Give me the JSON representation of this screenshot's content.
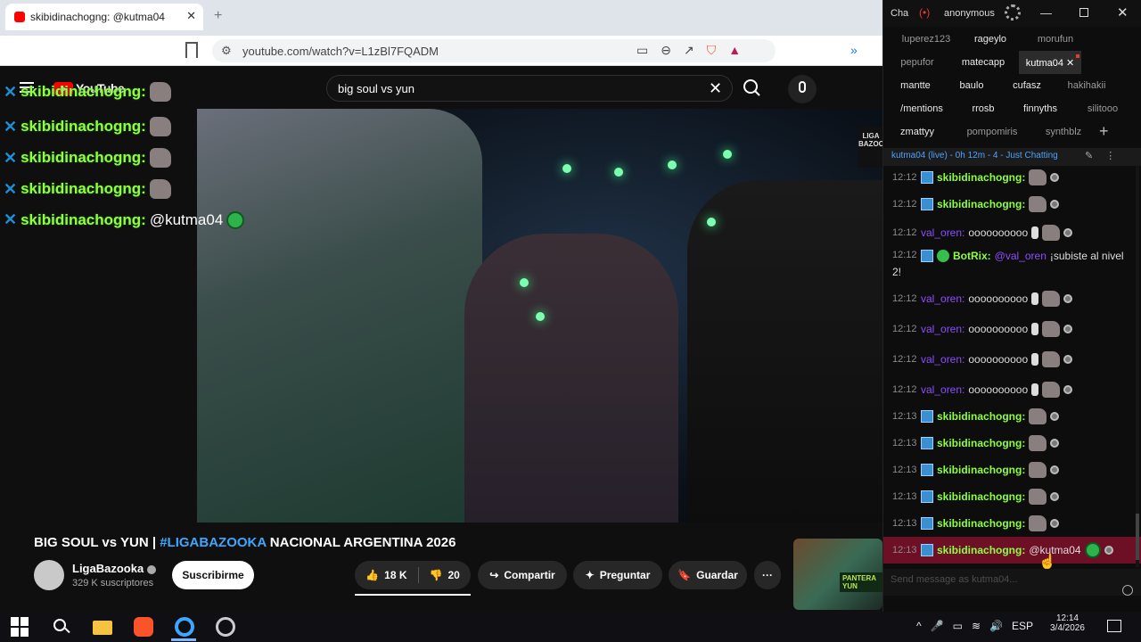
{
  "browser": {
    "tab_title": "skibidinachogng: @kutma04",
    "address_url": "youtube.com/watch?v=L1zBl7FQADM"
  },
  "youtube": {
    "logo_text": "YouTube",
    "search_query": "big soul vs yun",
    "video_title_main": "BIG SOUL vs YUN | ",
    "video_title_tag": "#LIGABAZOOKA",
    "video_title_rest": " NACIONAL ARGENTINA 2026",
    "channel_name": "LigaBazooka",
    "subscribers": "329 K suscriptores",
    "subscribe_label": "Suscribirme",
    "like_count": "18 K",
    "dislike_count": "20",
    "share_label": "Compartir",
    "ask_label": "Preguntar",
    "save_label": "Guardar",
    "more_label": "···",
    "video_badge": "LIGA BAZOOKA",
    "thumb_label": "PANTERA YUN"
  },
  "overlay": {
    "username": "skibidinachogng:",
    "lines": [
      "",
      "",
      "",
      "",
      "@kutma04"
    ]
  },
  "chatterino": {
    "app": "Cha",
    "user": "anonymous",
    "tabs": [
      {
        "label": "luperez123"
      },
      {
        "label": "rageylo"
      },
      {
        "label": "morufun"
      },
      {
        "label": "pepufor"
      },
      {
        "label": "matecapp"
      },
      {
        "label": "kutma04 ✕"
      },
      {
        "label": "mantte"
      },
      {
        "label": "baulo"
      },
      {
        "label": "cufasz"
      },
      {
        "label": "hakihakii"
      },
      {
        "label": "/mentions"
      },
      {
        "label": "rrosb"
      },
      {
        "label": "finnyths"
      },
      {
        "label": "silitooo"
      },
      {
        "label": "zmattyy"
      },
      {
        "label": "pompomiris"
      },
      {
        "label": "synthblz"
      }
    ],
    "add_tab": "+",
    "header": "kutma04 (live) - 0h 12m - 4 - Just Chatting",
    "input_placeholder": "Send message as kutma04...",
    "messages": [
      {
        "time": "12:12",
        "name": "skibidinachogng:",
        "text": ""
      },
      {
        "time": "12:12",
        "name": "skibidinachogng:",
        "text": ""
      },
      {
        "time": "12:12",
        "name": "val_oren:",
        "text": "oooooooooo"
      },
      {
        "time": "12:12",
        "name": "BotRix:",
        "mention": "@val_oren",
        "text": "¡subiste al nivel",
        "text2": "2!"
      },
      {
        "time": "12:12",
        "name": "val_oren:",
        "text": "oooooooooo"
      },
      {
        "time": "12:12",
        "name": "val_oren:",
        "text": "oooooooooo"
      },
      {
        "time": "12:12",
        "name": "val_oren:",
        "text": "oooooooooo"
      },
      {
        "time": "12:12",
        "name": "val_oren:",
        "text": "oooooooooo"
      },
      {
        "time": "12:13",
        "name": "skibidinachogng:",
        "text": ""
      },
      {
        "time": "12:13",
        "name": "skibidinachogng:",
        "text": ""
      },
      {
        "time": "12:13",
        "name": "skibidinachogng:",
        "text": ""
      },
      {
        "time": "12:13",
        "name": "skibidinachogng:",
        "text": ""
      },
      {
        "time": "12:13",
        "name": "skibidinachogng:",
        "text": ""
      },
      {
        "time": "12:13",
        "name": "skibidinachogng:",
        "text": "@kutma04"
      }
    ]
  },
  "taskbar": {
    "lang": "ESP",
    "time": "12:14",
    "date": "3/4/2026"
  },
  "colors": {
    "highlight": "#6e1025",
    "username_green": "#8cff44",
    "username_purple": "#8c4dff",
    "yt_link": "#3ea6ff"
  }
}
